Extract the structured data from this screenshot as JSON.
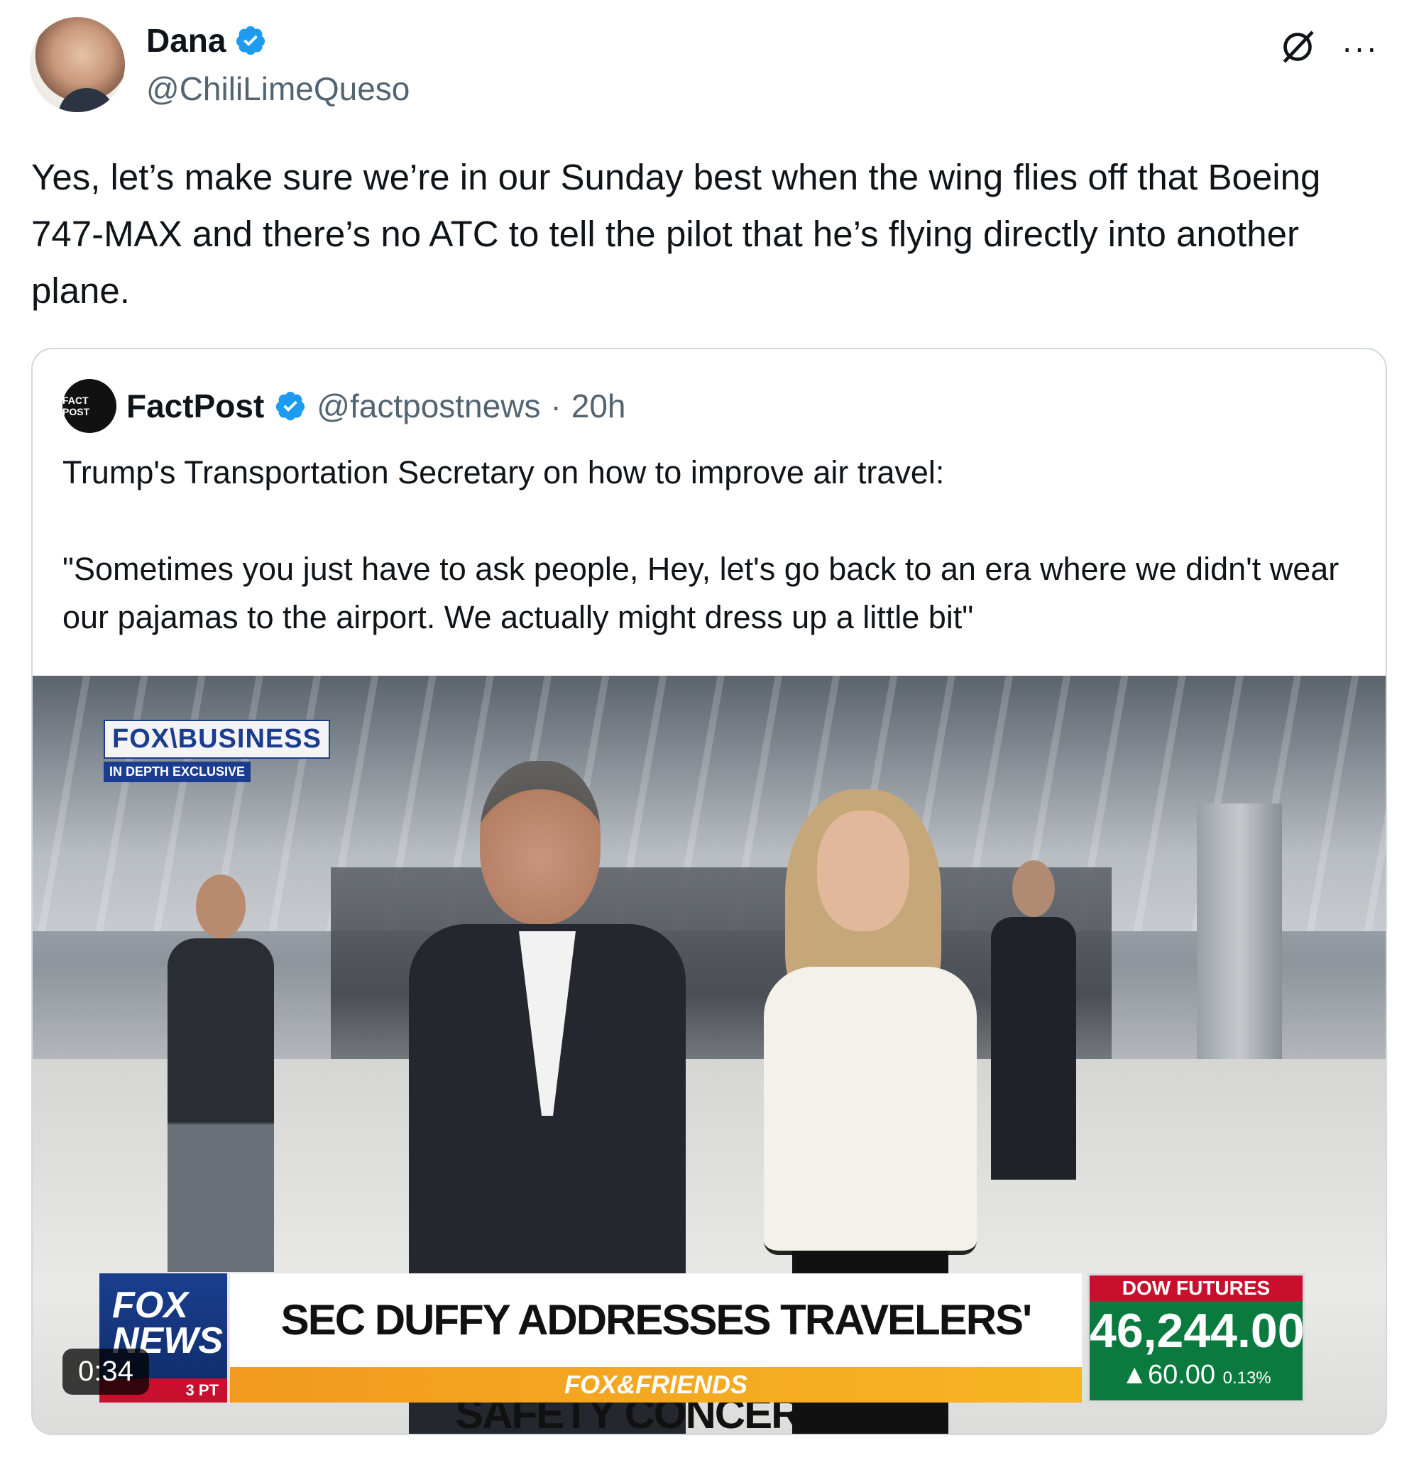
{
  "author": {
    "name": "Dana",
    "handle": "@ChiliLimeQueso"
  },
  "tweet_text": "Yes, let’s make sure we’re in our Sunday best when the wing flies off that Boeing 747-MAX and there’s no ATC to tell the pilot that he’s flying directly into another plane.",
  "more_label": "···",
  "quoted": {
    "avatar_text": "FACT POST",
    "name": "FactPost",
    "handle": "@factpostnews",
    "separator": "·",
    "time": "20h",
    "text": "Trump's Transportation Secretary on how to improve air travel:\n\n\"Sometimes you just have to ask people, Hey, let's go back to an era where we didn't wear our pajamas to the airport. We actually might dress up a little bit\"",
    "video": {
      "duration": "0:34",
      "network_logo": "FOX\\BUSINESS",
      "network_sub": "IN DEPTH EXCLUSIVE",
      "fox_news_logo": "FOX NEWS",
      "time_tag": "3 PT",
      "headline": "SEC DUFFY ADDRESSES TRAVELERS' SAFETY CONCERNS",
      "show": "FOX&FRIENDS",
      "ticker_label": "DOW FUTURES",
      "ticker_value": "46,244.00",
      "ticker_change": "▲60.00",
      "ticker_pct": "0.13%"
    }
  },
  "colors": {
    "verified": "#1d9bf0",
    "secondary_text": "#536471",
    "border": "#cfd9de"
  }
}
